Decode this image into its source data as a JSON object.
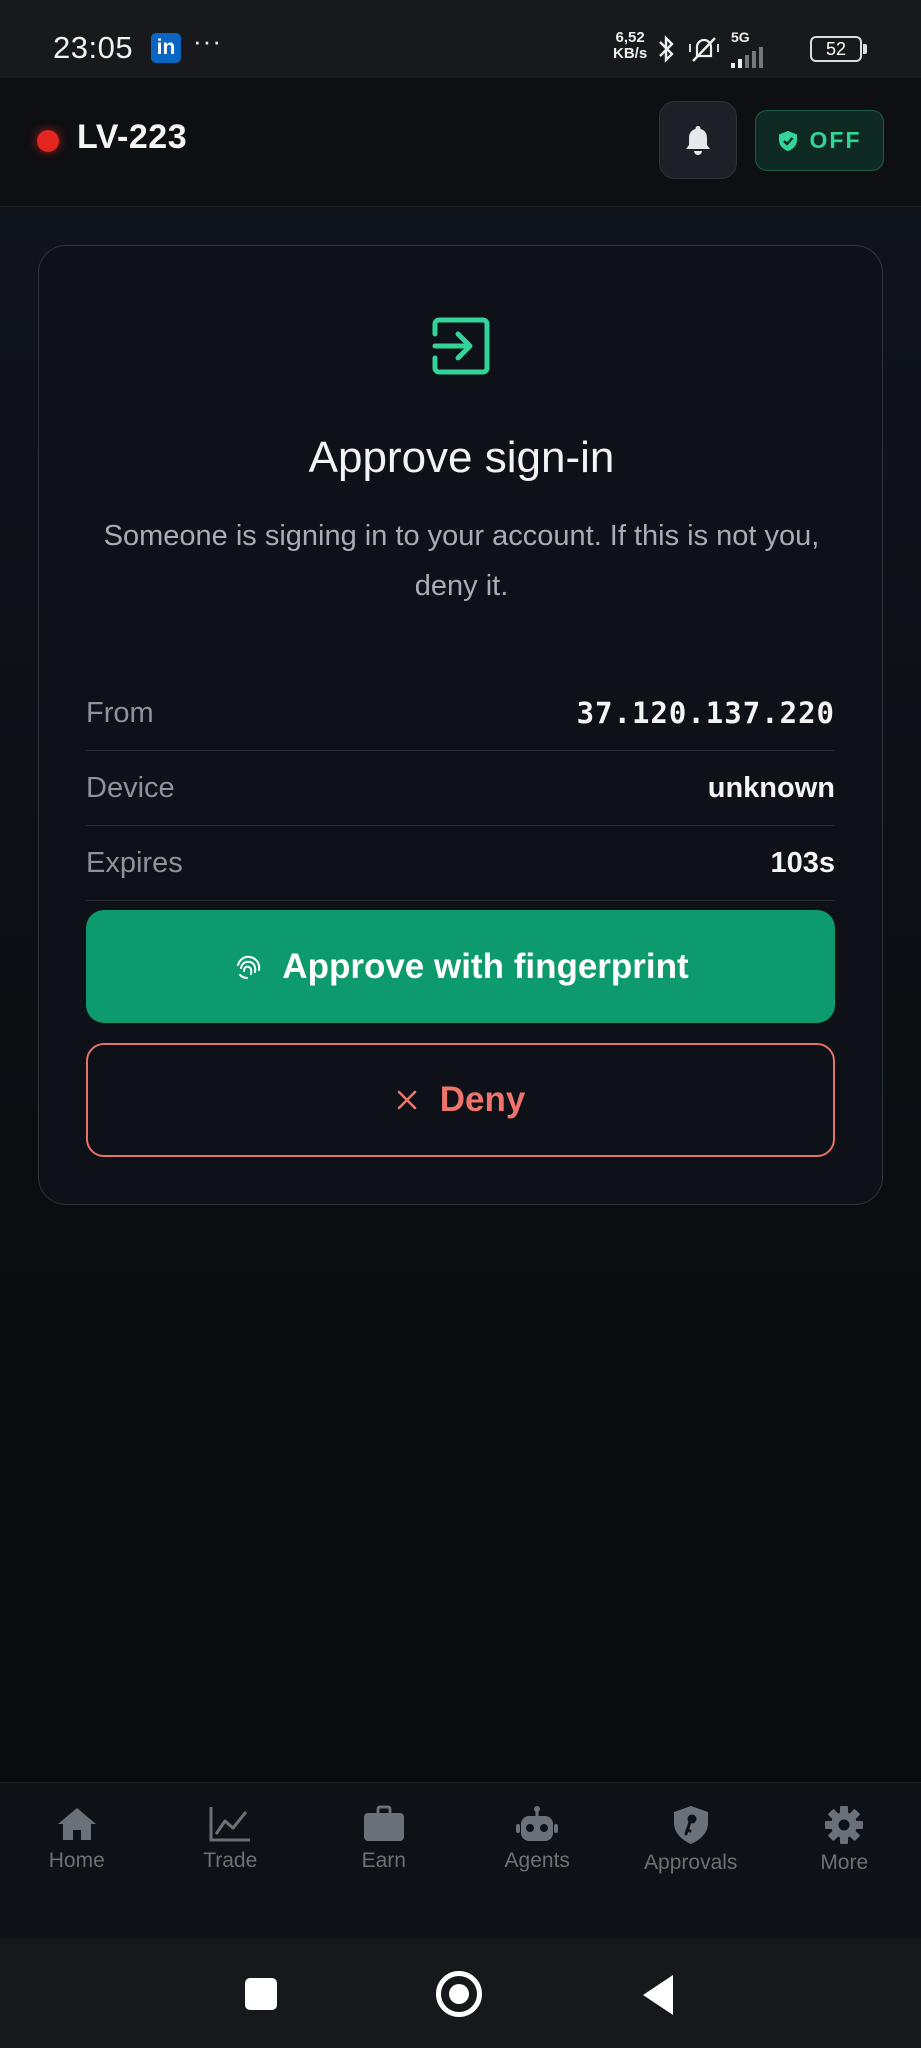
{
  "status_bar": {
    "time": "23:05",
    "app_badge": "in",
    "overflow": "···",
    "net_speed_value": "6,52",
    "net_speed_unit": "KB/s",
    "network": "5G",
    "battery": "52"
  },
  "header": {
    "title": "LV-223",
    "status_color": "#e3261f",
    "toggle_label": "OFF"
  },
  "card": {
    "icon": "sign-in-icon",
    "title": "Approve sign-in",
    "subtitle": "Someone is signing in to your account. If this is not you, deny it.",
    "details": [
      {
        "label": "From",
        "value": "37.120.137.220"
      },
      {
        "label": "Device",
        "value": "unknown"
      },
      {
        "label": "Expires",
        "value": "103s"
      }
    ],
    "approve_label": "Approve with fingerprint",
    "deny_label": "Deny",
    "accent_color": "#0d9a6c",
    "deny_color": "#ef746c"
  },
  "nav": {
    "items": [
      {
        "label": "Home",
        "icon": "home-icon"
      },
      {
        "label": "Trade",
        "icon": "chart-line-icon"
      },
      {
        "label": "Earn",
        "icon": "briefcase-icon"
      },
      {
        "label": "Agents",
        "icon": "robot-icon"
      },
      {
        "label": "Approvals",
        "icon": "shield-key-icon"
      },
      {
        "label": "More",
        "icon": "gear-icon"
      }
    ]
  }
}
